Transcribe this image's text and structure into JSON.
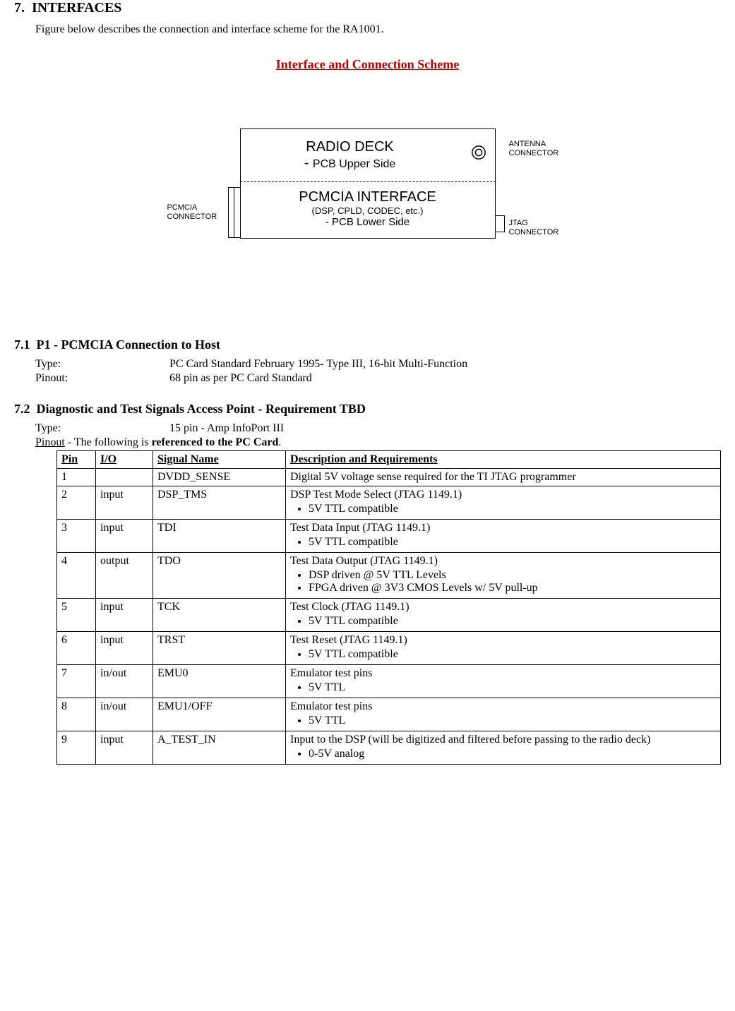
{
  "heading_num": "7.",
  "heading_text": "INTERFACES",
  "intro": "Figure below describes the connection and interface scheme for the RA1001.",
  "scheme_title": "Interface and Connection Scheme",
  "diagram": {
    "radio_title": "RADIO DECK",
    "radio_sub_prefix": "- ",
    "radio_sub": "PCB Upper Side",
    "pcmcia_title": "PCMCIA INTERFACE",
    "pcmcia_sub1": "(DSP, CPLD, CODEC, etc.)",
    "pcmcia_sub2": "- PCB Lower Side",
    "label_antenna_l1": "ANTENNA",
    "label_antenna_l2": "CONNECTOR",
    "label_jtag_l1": "JTAG",
    "label_jtag_l2": "CONNECTOR",
    "label_pcmcia_l1": "PCMCIA",
    "label_pcmcia_l2": "CONNECTOR"
  },
  "sec71": {
    "num": "7.1",
    "title": "P1 - PCMCIA Connection to Host",
    "type_label": "Type:",
    "type_val": "PC Card Standard February 1995- Type III, 16-bit Multi-Function",
    "pinout_label": "Pinout:",
    "pinout_val": "68 pin as per PC Card Standard"
  },
  "sec72": {
    "num": "7.2",
    "title": "Diagnostic and Test Signals Access Point  -  Requirement TBD",
    "type_label": "Type:",
    "type_val": "15 pin - Amp InfoPort III",
    "pinout_intro_pre": "Pinout",
    "pinout_intro_mid": " - The following is ",
    "pinout_intro_bold": "referenced to the PC Card",
    "pinout_intro_post": ".",
    "th_pin": "Pin",
    "th_io": "I/O",
    "th_sig": "Signal Name",
    "th_desc": "Description and Requirements",
    "rows": [
      {
        "pin": "1",
        "io": "",
        "sig": "DVDD_SENSE",
        "desc": "Digital 5V voltage sense required for the TI JTAG programmer",
        "bullets": []
      },
      {
        "pin": "2",
        "io": "input",
        "sig": "DSP_TMS",
        "desc": "DSP Test Mode Select (JTAG 1149.1)",
        "bullets": [
          "5V TTL compatible"
        ]
      },
      {
        "pin": "3",
        "io": "input",
        "sig": "TDI",
        "desc": "Test Data Input (JTAG 1149.1)",
        "bullets": [
          "5V TTL compatible"
        ]
      },
      {
        "pin": "4",
        "io": "output",
        "sig": "TDO",
        "desc": "Test Data Output (JTAG 1149.1)",
        "bullets": [
          "DSP driven @ 5V TTL Levels",
          "FPGA driven @ 3V3 CMOS Levels w/ 5V pull-up"
        ]
      },
      {
        "pin": "5",
        "io": "input",
        "sig": "TCK",
        "desc": "Test Clock  (JTAG 1149.1)",
        "bullets": [
          "5V TTL compatible"
        ]
      },
      {
        "pin": "6",
        "io": "input",
        "sig": "TRST",
        "desc": "Test Reset (JTAG 1149.1)",
        "bullets": [
          "5V TTL compatible"
        ]
      },
      {
        "pin": "7",
        "io": "in/out",
        "sig": "EMU0",
        "desc": "Emulator test pins",
        "bullets": [
          "5V TTL"
        ]
      },
      {
        "pin": "8",
        "io": "in/out",
        "sig": "EMU1/OFF",
        "desc": "Emulator test pins",
        "bullets": [
          "5V TTL"
        ]
      },
      {
        "pin": "9",
        "io": "input",
        "sig": "A_TEST_IN",
        "desc": "Input to the DSP (will be digitized and filtered before passing to the radio deck)",
        "bullets": [
          "0-5V analog"
        ]
      }
    ]
  }
}
